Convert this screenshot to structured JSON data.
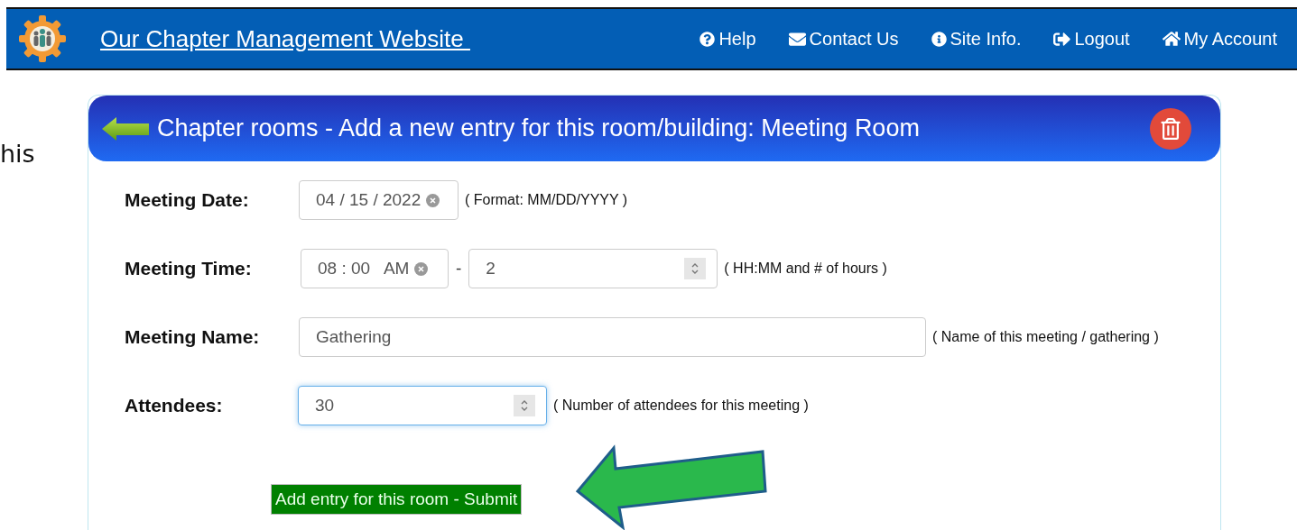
{
  "navbar": {
    "title": "Our Chapter Management Website ",
    "links": [
      {
        "kind": "help",
        "label": "Help"
      },
      {
        "kind": "mail",
        "label": "Contact Us"
      },
      {
        "kind": "info",
        "label": "Site Info."
      },
      {
        "kind": "logout",
        "label": "Logout"
      },
      {
        "kind": "home",
        "label": "My Account"
      }
    ]
  },
  "side_text": "his",
  "panel": {
    "title": "Chapter rooms - Add a new entry for this room/building: Meeting Room"
  },
  "form": {
    "rows": [
      {
        "label": "Meeting Date:",
        "kind": "date",
        "value": "04 / 15 / 2022",
        "focused": false,
        "hint": "( Format: MM/DD/YYYY )"
      },
      {
        "label": "Meeting Time:",
        "kind": "time",
        "value": "08 : 00   AM",
        "separator": "-",
        "duration": "2",
        "focused": false,
        "hint": "( HH:MM and # of hours )"
      },
      {
        "label": "Meeting Name:",
        "kind": "text",
        "value": "Gathering",
        "focused": false,
        "hint": "( Name of this meeting / gathering )"
      },
      {
        "label": "Attendees:",
        "kind": "number",
        "value": "30",
        "focused": true,
        "hint": "( Number of attendees for this meeting )"
      }
    ],
    "submit": "Add entry for this room - Submit"
  }
}
